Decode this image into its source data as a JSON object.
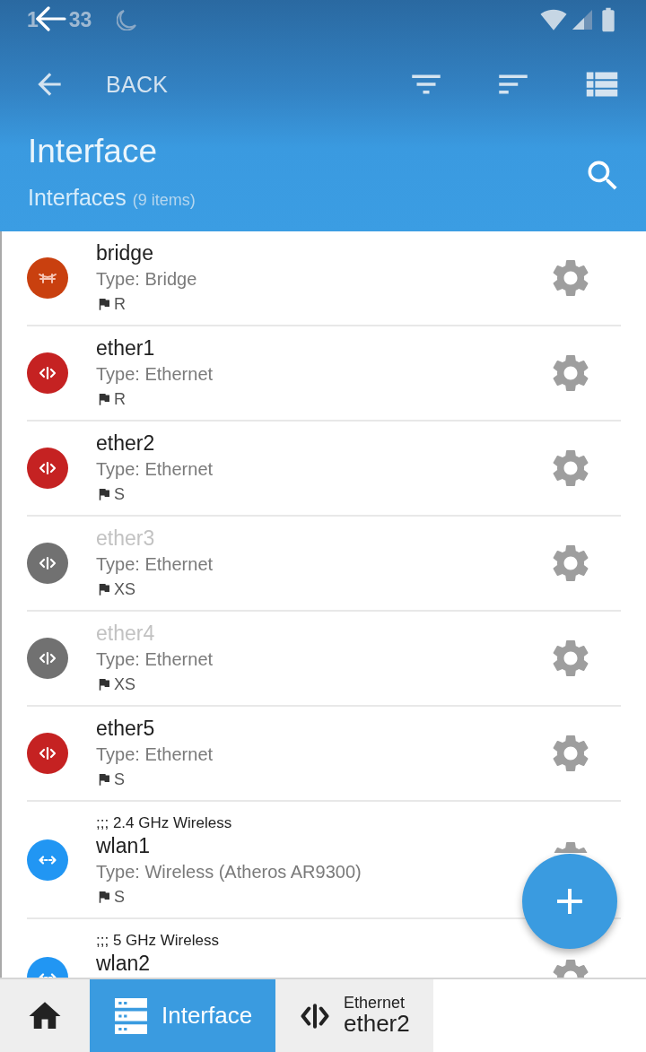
{
  "status_bar": {
    "time_visible": [
      "1",
      "33"
    ]
  },
  "toolbar": {
    "back_label": "BACK"
  },
  "header": {
    "title": "Interface",
    "subtitle": "Interfaces",
    "count": "(9 items)"
  },
  "interfaces": [
    {
      "name": "bridge",
      "type": "Type: Bridge",
      "flags": "R",
      "kind": "bridge",
      "disabled": false
    },
    {
      "name": "ether1",
      "type": "Type: Ethernet",
      "flags": "R",
      "kind": "ethernet",
      "disabled": false
    },
    {
      "name": "ether2",
      "type": "Type: Ethernet",
      "flags": "S",
      "kind": "ethernet",
      "disabled": false
    },
    {
      "name": "ether3",
      "type": "Type: Ethernet",
      "flags": "XS",
      "kind": "ethernet",
      "disabled": true
    },
    {
      "name": "ether4",
      "type": "Type: Ethernet",
      "flags": "XS",
      "kind": "ethernet",
      "disabled": true
    },
    {
      "name": "ether5",
      "type": "Type: Ethernet",
      "flags": "S",
      "kind": "ethernet",
      "disabled": false
    },
    {
      "comment": ";;; 2.4 GHz Wireless",
      "name": "wlan1",
      "type": "Type: Wireless (Atheros AR9300)",
      "flags": "S",
      "kind": "wireless",
      "disabled": false
    },
    {
      "comment": ";;; 5 GHz Wireless",
      "name": "wlan2",
      "kind": "wireless",
      "disabled": false
    }
  ],
  "bottom_bar": {
    "tabs": [
      {
        "kind": "home",
        "selected": false
      },
      {
        "kind": "list",
        "label": "Interface",
        "selected": true
      },
      {
        "kind": "ethernet",
        "caption": "Ethernet",
        "label": "ether2",
        "selected": false
      }
    ]
  }
}
